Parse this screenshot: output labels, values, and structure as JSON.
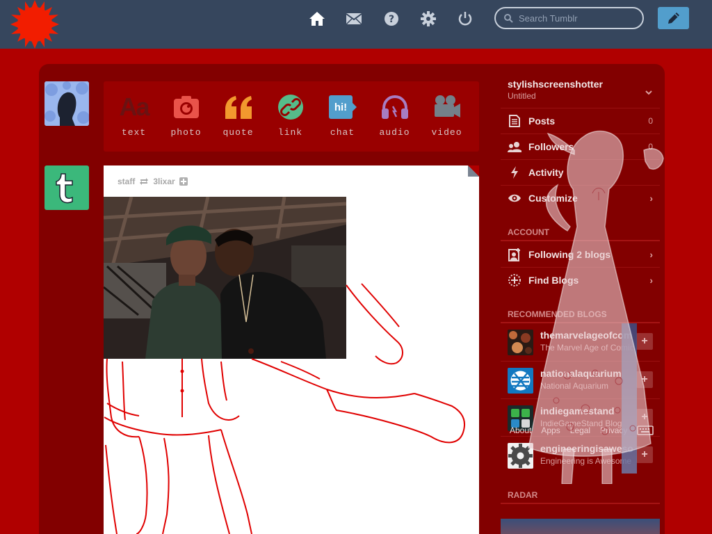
{
  "header": {
    "search_placeholder": "Search Tumblr",
    "nav": [
      "home-icon",
      "mail-icon",
      "help-icon",
      "gear-icon",
      "power-icon"
    ],
    "colors": {
      "bar": "#36465d",
      "compose": "#529ecc",
      "background": "#b00000"
    }
  },
  "post_types": [
    {
      "label": "text",
      "icon": "text-icon",
      "color": "#7a1616"
    },
    {
      "label": "photo",
      "icon": "camera-icon",
      "color": "#e9534a"
    },
    {
      "label": "quote",
      "icon": "quote-icon",
      "color": "#f2992e"
    },
    {
      "label": "link",
      "icon": "link-icon",
      "color": "#56bc8a"
    },
    {
      "label": "chat",
      "icon": "chat-icon",
      "color": "#529ecc"
    },
    {
      "label": "audio",
      "icon": "headphones-icon",
      "color": "#a77dc2"
    },
    {
      "label": "video",
      "icon": "video-icon",
      "color": "#748089"
    }
  ],
  "post": {
    "author": "staff",
    "reblogged_from": "3lixar"
  },
  "sidebar": {
    "blog_name": "stylishscreenshotter",
    "blog_subtitle": "Untitled",
    "items": [
      {
        "label": "Posts",
        "count": "0"
      },
      {
        "label": "Followers",
        "count": "0"
      },
      {
        "label": "Activity"
      },
      {
        "label": "Customize"
      }
    ],
    "account_header": "ACCOUNT",
    "account_items": [
      {
        "label": "Following 2 blogs"
      },
      {
        "label": "Find Blogs"
      }
    ],
    "recommended_header": "RECOMMENDED BLOGS",
    "recommended": [
      {
        "name": "themarvelageofcomics",
        "subtitle": "The Marvel Age of Comics"
      },
      {
        "name": "nationalaquarium",
        "subtitle": "National Aquarium"
      },
      {
        "name": "indiegamestand",
        "subtitle": "IndieGameStand Blog"
      },
      {
        "name": "engineeringisawesome",
        "subtitle": "Engineering is Awesome"
      }
    ],
    "footer_links": [
      "About",
      "Apps",
      "Legal",
      "Privacy"
    ],
    "radar_header": "RADAR"
  }
}
